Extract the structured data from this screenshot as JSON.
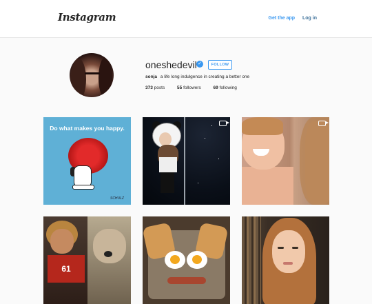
{
  "header": {
    "logo_text": "Instagram",
    "get_app_label": "Get the app",
    "login_label": "Log in"
  },
  "profile": {
    "username": "oneshedevil",
    "verified": true,
    "follow_label": "FOLLOW",
    "display_name": "sonja",
    "bio": "a life long indulgence in creating a better one",
    "stats": [
      {
        "count": "373",
        "label": "posts"
      },
      {
        "count": "55",
        "label": "followers"
      },
      {
        "count": "69",
        "label": "following"
      }
    ]
  },
  "posts": [
    {
      "caption_text": "Do what makes you happy.",
      "signature": "SCHULZ",
      "is_video": false
    },
    {
      "is_video": true
    },
    {
      "is_video": true
    },
    {
      "jersey_number": "61",
      "is_video": false
    },
    {
      "is_video": false
    },
    {
      "is_video": false
    }
  ],
  "colors": {
    "accent": "#3897f0",
    "link_dark": "#3f729b",
    "background": "#fafafa"
  }
}
